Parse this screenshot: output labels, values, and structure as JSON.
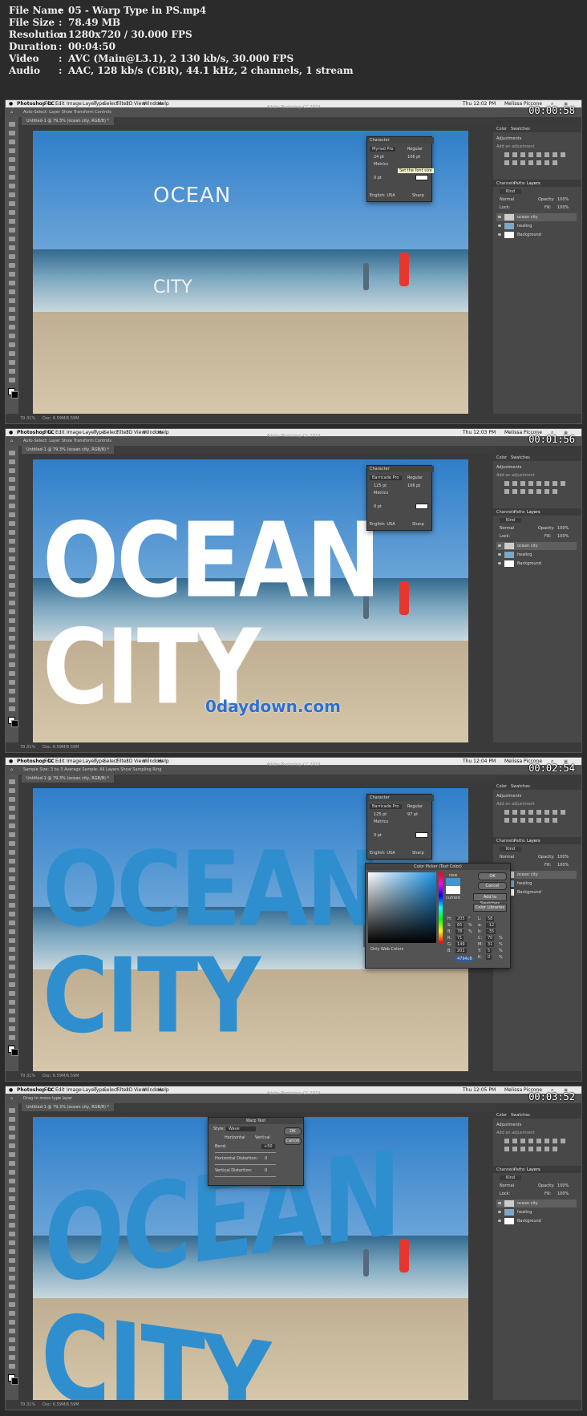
{
  "file_info": [
    {
      "key": "File Name",
      "value": "05 - Warp Type in PS.mp4"
    },
    {
      "key": "File Size",
      "value": "78.49 MB"
    },
    {
      "key": "Resolution",
      "value": "1280x720 / 30.000 FPS"
    },
    {
      "key": "Duration",
      "value": "00:04:50"
    },
    {
      "key": "Video",
      "value": "AVC (Main@L3.1), 2 130 kb/s, 30.000 FPS"
    },
    {
      "key": "Audio",
      "value": "AAC, 128 kb/s (CBR), 44.1 kHz, 2 channels, 1 stream"
    }
  ],
  "common": {
    "app_menu": [
      "Photoshop CC",
      "File",
      "Edit",
      "Image",
      "Layer",
      "Type",
      "Select",
      "Filter",
      "3D",
      "View",
      "Window",
      "Help"
    ],
    "app_title": "Adobe Photoshop CC 2019",
    "user": "Melissa Piccone",
    "doc_tab": "Untitled-1 @ 79.3% (ocean city, RGB/8) *",
    "status_zoom": "79.31%",
    "status_doc": "Doc: 6.59M/6.59M",
    "color_tab": "Color",
    "swatches_tab": "Swatches",
    "adjustments_title": "Adjustments",
    "add_adjustment": "Add an adjustment",
    "channels_tab": "Channels",
    "paths_tab": "Paths",
    "layers_tab": "Layers",
    "kind_filter": "Kind",
    "blend_mode": "Normal",
    "opacity_label": "Opacity:",
    "opacity_value": "100%",
    "lock_label": "Lock:",
    "fill_label": "Fill:",
    "fill_value": "100%",
    "layers": [
      "ocean city",
      "healing",
      "Background"
    ],
    "character_title": "Character",
    "font_style": "Regular",
    "language": "English: USA",
    "antialias": "Sharp",
    "metrics": "Metrics",
    "zero_pt": "0 pt"
  },
  "frames": [
    {
      "timestamp": "00:00:58",
      "clock": "Thu 12:02 PM",
      "options": "Auto-Select:   Layer    Show Transform Controls",
      "text_line1": "OCEAN",
      "text_line2": "CITY",
      "font": "Myriad Pro",
      "size": "24 pt",
      "leading": "106 pt",
      "tooltip": "Set the font size"
    },
    {
      "timestamp": "00:01:56",
      "clock": "Thu 12:03 PM",
      "options": "Auto-Select:   Layer    Show Transform Controls",
      "text_line1": "OCEAN",
      "text_line2": "CITY",
      "font": "Barricade Pro",
      "size": "125 pt",
      "leading": "106 pt",
      "watermark": "0daydown.com"
    },
    {
      "timestamp": "00:02:54",
      "clock": "Thu 12:04 PM",
      "options": "Sample Size:  3 by 3 Average    Sample:  All Layers    Show Sampling Ring",
      "text_line1": "OCEAN",
      "text_line2": "CITY",
      "font": "Barricade Pro",
      "size": "125 pt",
      "leading": "97 pt",
      "picker": {
        "title": "Color Picker (Text Color)",
        "ok": "OK",
        "cancel": "Cancel",
        "new_label": "new",
        "current_label": "current",
        "add_swatches": "Add to Swatches",
        "libraries": "Color Libraries",
        "only_web": "Only Web Colors",
        "hex": "4794c8",
        "fields": [
          {
            "label": "H:",
            "value": "205",
            "unit": "°"
          },
          {
            "label": "S:",
            "value": "65",
            "unit": "%"
          },
          {
            "label": "B:",
            "value": "78",
            "unit": "%"
          },
          {
            "label": "R:",
            "value": "71",
            "unit": ""
          },
          {
            "label": "G:",
            "value": "149",
            "unit": ""
          },
          {
            "label": "B:",
            "value": "201",
            "unit": ""
          }
        ],
        "lab": [
          {
            "label": "L:",
            "value": "58"
          },
          {
            "label": "a:",
            "value": "-12"
          },
          {
            "label": "b:",
            "value": "-35"
          },
          {
            "label": "C:",
            "value": "70",
            "unit": "%"
          },
          {
            "label": "M:",
            "value": "31",
            "unit": "%"
          },
          {
            "label": "Y:",
            "value": "5",
            "unit": "%"
          },
          {
            "label": "K:",
            "value": "0",
            "unit": "%"
          }
        ]
      }
    },
    {
      "timestamp": "00:03:52",
      "clock": "Thu 12:05 PM",
      "options": "Drag to move type layer",
      "text_line1": "OCEAN",
      "text_line2": "CITY",
      "warp": {
        "title": "Warp Text",
        "style_label": "Style:",
        "style_value": "Wave",
        "horizontal": "Horizontal",
        "vertical": "Vertical",
        "bend_label": "Bend:",
        "bend_value": "+50",
        "hdist_label": "Horizontal Distortion:",
        "hdist_value": "0",
        "vdist_label": "Vertical Distortion:",
        "vdist_value": "0",
        "ok": "OK",
        "cancel": "Cancel"
      }
    }
  ]
}
